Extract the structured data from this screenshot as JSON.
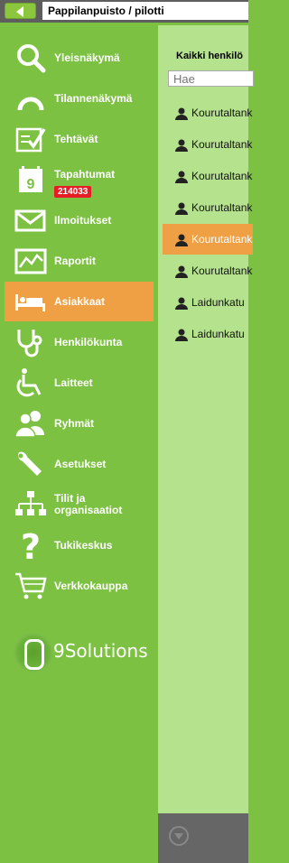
{
  "topbar": {
    "back_label": "",
    "breadcrumb": "Pappilanpuisto / pilotti"
  },
  "sidebar": {
    "items": [
      {
        "key": "overview",
        "label": "Yleisnäkymä",
        "icon": "search-icon"
      },
      {
        "key": "status",
        "label": "Tilannenäkymä",
        "icon": "gauge-icon"
      },
      {
        "key": "tasks",
        "label": "Tehtävät",
        "icon": "checklist-icon"
      },
      {
        "key": "events",
        "label": "Tapahtumat",
        "icon": "calendar-icon",
        "badge": "214033"
      },
      {
        "key": "notifications",
        "label": "Ilmoitukset",
        "icon": "envelope-icon"
      },
      {
        "key": "reports",
        "label": "Raportit",
        "icon": "chart-icon"
      },
      {
        "key": "clients",
        "label": "Asiakkaat",
        "icon": "bed-icon",
        "active": true
      },
      {
        "key": "staff",
        "label": "Henkilökunta",
        "icon": "stethoscope-icon"
      },
      {
        "key": "devices",
        "label": "Laitteet",
        "icon": "wheelchair-icon"
      },
      {
        "key": "groups",
        "label": "Ryhmät",
        "icon": "group-icon"
      },
      {
        "key": "settings",
        "label": "Asetukset",
        "icon": "wrench-icon"
      },
      {
        "key": "accounts",
        "label": "Tilit ja organisaatiot",
        "icon": "org-chart-icon"
      },
      {
        "key": "support",
        "label": "Tukikeskus",
        "icon": "question-icon"
      },
      {
        "key": "shop",
        "label": "Verkkokauppa",
        "icon": "cart-icon"
      }
    ],
    "brand": "9Solutions"
  },
  "main": {
    "title": "Kaikki henkilö",
    "search_placeholder": "Hae",
    "rows": [
      {
        "text": "Kourutaltank",
        "active": false
      },
      {
        "text": "Kourutaltank",
        "active": false
      },
      {
        "text": "Kourutaltank",
        "active": false
      },
      {
        "text": "Kourutaltank",
        "active": false
      },
      {
        "text": "Kourutaltank",
        "active": true
      },
      {
        "text": "Kourutaltank",
        "active": false
      },
      {
        "text": "Laidunkatu",
        "active": false
      },
      {
        "text": "Laidunkatu",
        "active": false
      }
    ]
  },
  "colors": {
    "sidebar_bg": "#7dc142",
    "active_bg": "#f0a044",
    "panel_bg": "#b5e28c",
    "badge_bg": "#e81c24"
  }
}
